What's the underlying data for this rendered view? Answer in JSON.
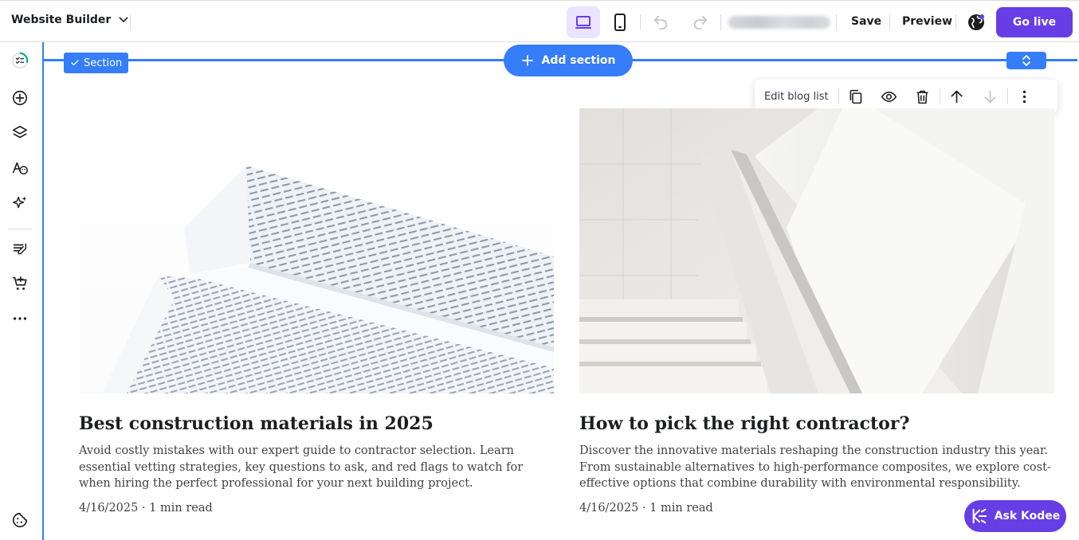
{
  "topbar": {
    "app_name": "Website Builder",
    "save_label": "Save",
    "preview_label": "Preview",
    "go_live_label": "Go live"
  },
  "canvas": {
    "section_tag": "Section",
    "add_section_label": "Add section",
    "toolbar": {
      "edit_label": "Edit blog list"
    }
  },
  "posts": [
    {
      "title": "Best construction materials in 2025",
      "excerpt": "Avoid costly mistakes with our expert guide to contractor selection. Learn essential vetting strategies, key questions to ask, and red flags to watch for when hiring the perfect professional for your next building project.",
      "meta": "4/16/2025 · 1 min read"
    },
    {
      "title": "How to pick the right contractor?",
      "excerpt": "Discover the innovative materials reshaping the construction industry this year. From sustainable alternatives to high-performance composites, we explore cost-effective options that combine durability with environmental responsibility.",
      "meta": "4/16/2025 · 1 min read"
    }
  ],
  "assistant": {
    "label": "Ask Kodee"
  },
  "colors": {
    "brand_purple": "#673de6",
    "selection_blue": "#357df9",
    "active_device_bg": "#ebe4ff"
  }
}
